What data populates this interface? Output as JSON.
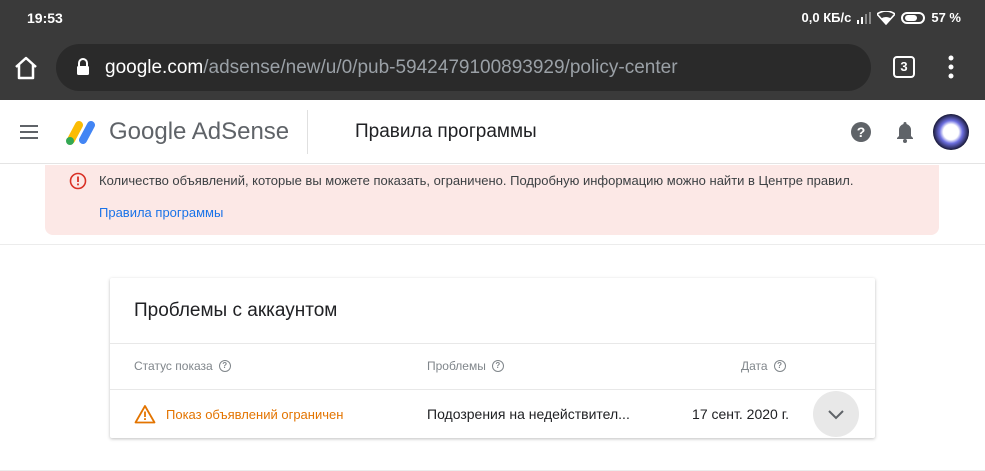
{
  "status_bar": {
    "time": "19:53",
    "net_speed": "0,0 КБ/с",
    "battery": "57 %"
  },
  "browser": {
    "url_host": "google.com",
    "url_path": "/adsense/new/u/0/pub-5942479100893929/policy-center",
    "tab_count": "3"
  },
  "header": {
    "brand": "Google AdSense",
    "title": "Правила программы"
  },
  "alert": {
    "message": "Количество объявлений, которые вы можете показать, ограничено. Подробную информацию можно найти в Центре правил.",
    "link": "Правила программы"
  },
  "card": {
    "title": "Проблемы с аккаунтом",
    "columns": [
      "Статус показа",
      "Проблемы",
      "Дата"
    ],
    "rows": [
      {
        "status": "Показ объявлений ограничен",
        "problem": "Подозрения на недействител...",
        "date": "17 сент. 2020 г."
      }
    ]
  },
  "colors": {
    "warning": "#e37400",
    "link": "#1a73e8",
    "alert_bg": "#fce8e6"
  },
  "icons": [
    "home-icon",
    "lock-icon",
    "menu-dots-icon",
    "hamburger-icon",
    "adsense-logo-icon",
    "help-icon",
    "bell-icon",
    "alert-circle-icon",
    "warning-triangle-icon",
    "chevron-down-icon"
  ]
}
